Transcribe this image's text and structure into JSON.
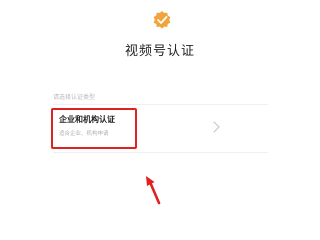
{
  "header": {
    "title": "视频号认证",
    "badge_icon": "verified-badge-icon",
    "badge_color": "#f0a43a"
  },
  "section": {
    "hint": "请选择认证类型"
  },
  "option": {
    "title": "企业和机构认证",
    "subtitle": "适合企业、机构申请",
    "chevron_icon": "chevron-right-icon"
  },
  "annotation": {
    "highlight_color": "#e0211d",
    "arrow_icon": "red-arrow-icon"
  }
}
